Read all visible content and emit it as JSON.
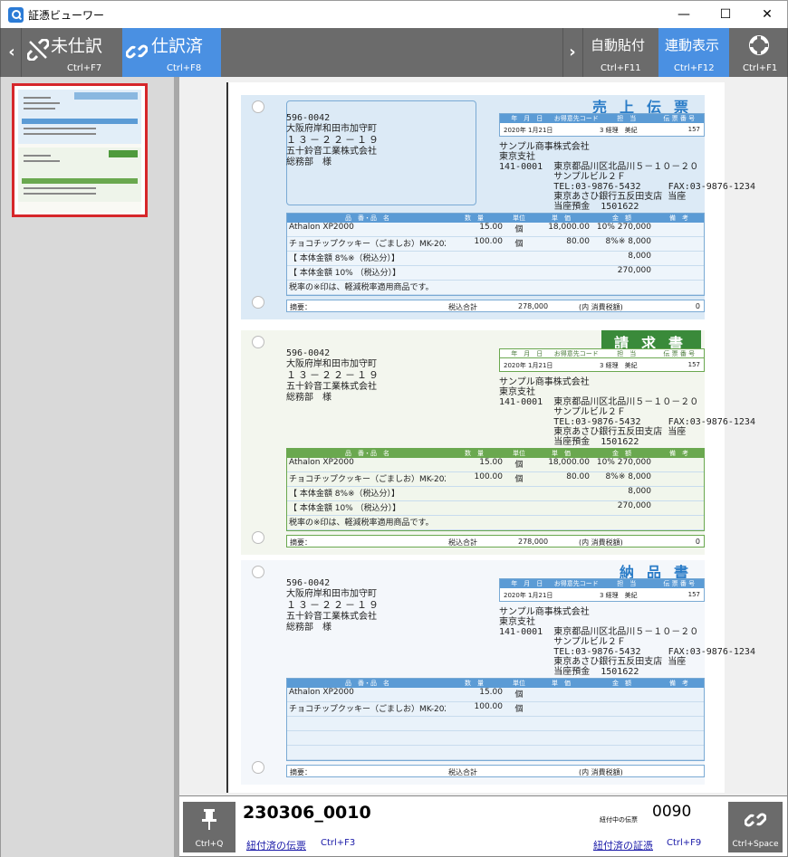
{
  "window": {
    "title": "証憑ビューワー",
    "minimize": "—",
    "maximize": "☐",
    "close": "✕"
  },
  "toolbar": {
    "prev_arrow": "‹",
    "unjournaled": {
      "label": "未仕訳",
      "shortcut": "Ctrl+F7"
    },
    "journaled": {
      "label": "仕訳済",
      "shortcut": "Ctrl+F8"
    },
    "next_arrow": "›",
    "auto_attach": {
      "label": "自動貼付",
      "shortcut": "Ctrl+F11"
    },
    "linked_display": {
      "label": "連動表示",
      "shortcut": "Ctrl+F12"
    },
    "help": {
      "shortcut": "Ctrl+F1"
    }
  },
  "document": {
    "slips": [
      {
        "title": "売上伝票",
        "header_cols": [
          "年　月　日",
          "お得意先コード",
          "担　当",
          "伝 票 番 号"
        ],
        "header_vals": [
          "2020年 1月21日",
          "3 経理　美紀",
          "157"
        ],
        "address": [
          "596-0042",
          "大阪府岸和田市加守町",
          "１３－２２－１９",
          "五十鈴音工業株式会社",
          "総務部　様"
        ],
        "sender": [
          "サンプル商事株式会社",
          "東京支社",
          "141-0001  東京都品川区北品川５－１０－２０",
          "          サンプルビル２Ｆ",
          "          TEL:03-9876-5432     FAX:03-9876-1234",
          "          東京あさひ銀行五反田支店 当座",
          "          当座預金  1501622"
        ],
        "cols": [
          "品　番・品　名",
          "数　量",
          "単位",
          "単　価",
          "金　額",
          "備　考"
        ],
        "rows": [
          [
            "Athalon  XP2000",
            "15.00",
            "個",
            "18,000.00",
            "10%  270,000",
            ""
          ],
          [
            "チョコチップクッキー（ごましお）MK-202",
            "100.00",
            "個",
            "80.00",
            "8%※  8,000",
            ""
          ],
          [
            "【 本体金額  8%※（税込分）】",
            "",
            "",
            "",
            "8,000",
            ""
          ],
          [
            "【 本体金額  10%  （税込分）】",
            "",
            "",
            "",
            "270,000",
            ""
          ],
          [
            "税率の※印は、軽減税率適用商品です。",
            "",
            "",
            "",
            "",
            ""
          ]
        ],
        "foot": {
          "memo": "摘要：",
          "total_label": "税込合計",
          "total": "278,000",
          "tax_label": "(内  消費税額)",
          "tax": "0"
        }
      },
      {
        "title": "請求書",
        "header_cols": [
          "年　月　日",
          "お得意先コード",
          "担　当",
          "伝 票 番 号"
        ],
        "header_vals": [
          "2020年 1月21日",
          "3 経理　美紀",
          "157"
        ],
        "address": [
          "596-0042",
          "大阪府岸和田市加守町",
          "１３－２２－１９",
          "五十鈴音工業株式会社",
          "総務部　様"
        ],
        "sender": [
          "サンプル商事株式会社",
          "東京支社",
          "141-0001  東京都品川区北品川５－１０－２０",
          "          サンプルビル２Ｆ",
          "          TEL:03-9876-5432     FAX:03-9876-1234",
          "          東京あさひ銀行五反田支店 当座",
          "          当座預金  1501622"
        ],
        "cols": [
          "品　番・品　名",
          "数　量",
          "単位",
          "単　価",
          "金　額",
          "備　考"
        ],
        "rows": [
          [
            "Athalon  XP2000",
            "15.00",
            "個",
            "18,000.00",
            "10%  270,000",
            ""
          ],
          [
            "チョコチップクッキー（ごましお）MK-202",
            "100.00",
            "個",
            "80.00",
            "8%※  8,000",
            ""
          ],
          [
            "【 本体金額  8%※（税込分）】",
            "",
            "",
            "",
            "8,000",
            ""
          ],
          [
            "【 本体金額  10%  （税込分）】",
            "",
            "",
            "",
            "270,000",
            ""
          ],
          [
            "税率の※印は、軽減税率適用商品です。",
            "",
            "",
            "",
            "",
            ""
          ]
        ],
        "foot": {
          "memo": "摘要：",
          "total_label": "税込合計",
          "total": "278,000",
          "tax_label": "(内  消費税額)",
          "tax": "0"
        }
      },
      {
        "title": "納品書",
        "header_cols": [
          "年　月　日",
          "お得意先コード",
          "担　当",
          "伝 票 番 号"
        ],
        "header_vals": [
          "2020年 1月21日",
          "3 経理　美紀",
          "157"
        ],
        "address": [
          "596-0042",
          "大阪府岸和田市加守町",
          "１３－２２－１９",
          "五十鈴音工業株式会社",
          "総務部　様"
        ],
        "sender": [
          "サンプル商事株式会社",
          "東京支社",
          "141-0001  東京都品川区北品川５－１０－２０",
          "          サンプルビル２Ｆ",
          "          TEL:03-9876-5432     FAX:03-9876-1234",
          "          東京あさひ銀行五反田支店 当座",
          "          当座預金  1501622"
        ],
        "cols": [
          "品　番・品　名",
          "数　量",
          "単位",
          "単　価",
          "金　額",
          "備　考"
        ],
        "rows": [
          [
            "Athalon  XP2000",
            "15.00",
            "個",
            "",
            "",
            ""
          ],
          [
            "チョコチップクッキー（ごましお）MK-202",
            "100.00",
            "個",
            "",
            "",
            ""
          ],
          [
            "",
            "",
            "",
            "",
            "",
            ""
          ],
          [
            "",
            "",
            "",
            "",
            "",
            ""
          ],
          [
            "",
            "",
            "",
            "",
            "",
            ""
          ]
        ],
        "foot": {
          "memo": "摘要：",
          "total_label": "税込合計",
          "total": "",
          "tax_label": "(内  消費税額)",
          "tax": ""
        }
      }
    ]
  },
  "bottom": {
    "pin_shortcut": "Ctrl+Q",
    "doc_id": "230306_0010",
    "linked_slip_link": "紐付済の伝票",
    "linked_slip_shortcut": "Ctrl+F3",
    "count_label": "紐付中の伝票",
    "count": "0090",
    "linked_voucher_link": "紐付済の証憑",
    "linked_voucher_shortcut": "Ctrl+F9",
    "link_shortcut": "Ctrl+Space"
  }
}
